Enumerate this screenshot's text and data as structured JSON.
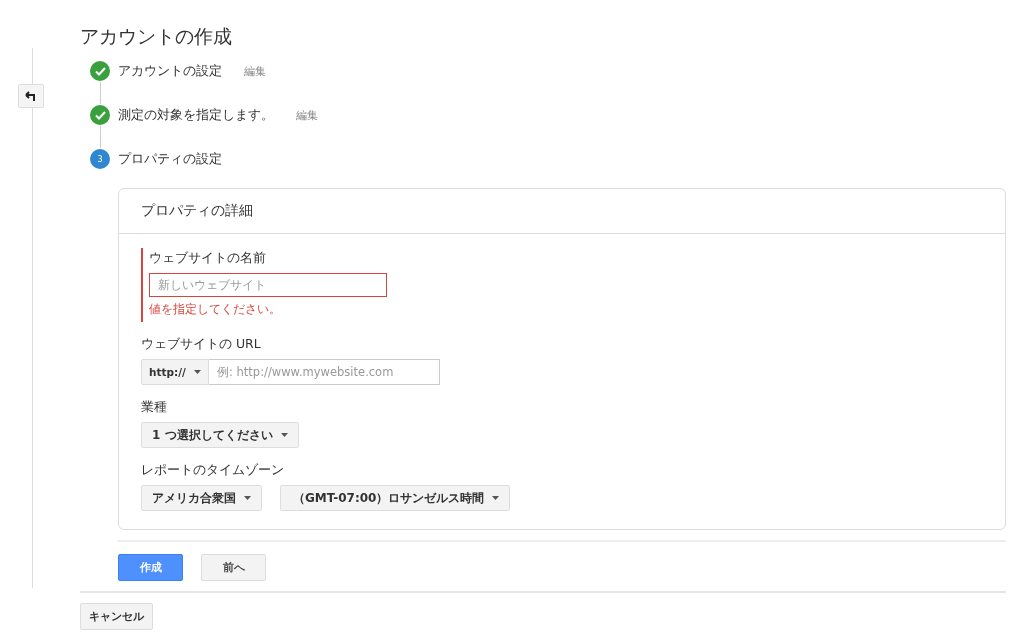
{
  "title": "アカウントの作成",
  "steps": [
    {
      "label": "アカウントの設定",
      "kind": "done",
      "edit": "編集"
    },
    {
      "label": "測定の対象を指定します。",
      "kind": "done",
      "edit": "編集"
    },
    {
      "label": "プロパティの設定",
      "kind": "current",
      "number": "3"
    }
  ],
  "card": {
    "title": "プロパティの詳細",
    "name_field": {
      "label": "ウェブサイトの名前",
      "placeholder": "新しいウェブサイト",
      "invalid": true,
      "error": "値を指定してください。"
    },
    "url_field": {
      "label": "ウェブサイトの URL",
      "protocol": "http://",
      "placeholder": "例: http://www.mywebsite.com"
    },
    "industry": {
      "label": "業種",
      "value": "1 つ選択してください"
    },
    "timezone": {
      "label": "レポートのタイムゾーン",
      "country": "アメリカ合衆国",
      "zone": "（GMT-07:00）ロサンゼルス時間"
    }
  },
  "buttons": [
    {
      "label": "作成",
      "kind": "primary"
    },
    {
      "label": "前へ",
      "kind": "secondary"
    }
  ],
  "cancel": "キャンセル"
}
